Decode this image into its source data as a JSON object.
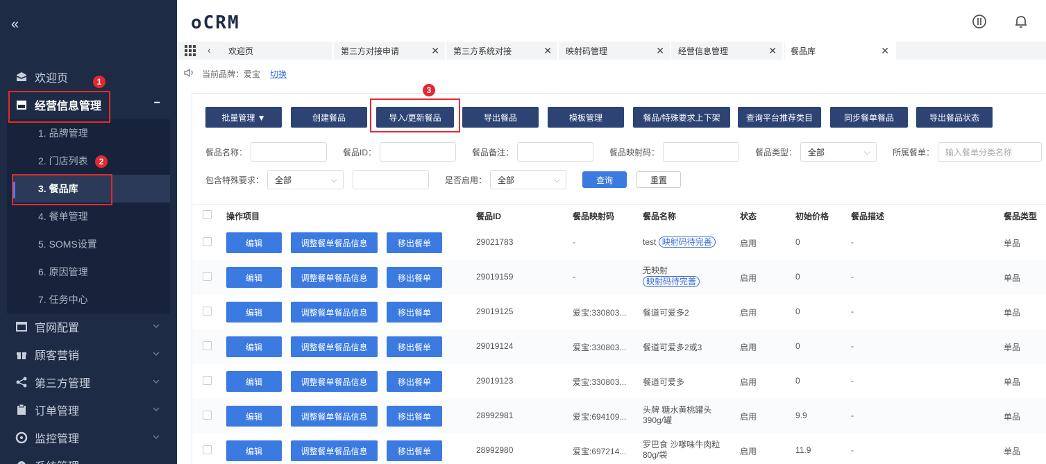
{
  "sidebar": {
    "collapse_icon": "«",
    "menu": [
      {
        "label": "欢迎页",
        "icon": "inbox-icon"
      },
      {
        "label": "经营信息管理",
        "icon": "storefront-icon",
        "open_symbol": "−"
      },
      {
        "label": "官网配置",
        "icon": "window-icon"
      },
      {
        "label": "顾客营销",
        "icon": "gift-icon"
      },
      {
        "label": "第三方管理",
        "icon": "share-icon"
      },
      {
        "label": "订单管理",
        "icon": "clipboard-icon"
      },
      {
        "label": "监控管理",
        "icon": "gauge-icon"
      },
      {
        "label": "系统管理",
        "icon": "gear-icon"
      }
    ],
    "submenu": [
      {
        "label": "1. 品牌管理"
      },
      {
        "label": "2. 门店列表"
      },
      {
        "label": "3. 餐品库"
      },
      {
        "label": "4. 餐单管理"
      },
      {
        "label": "5. SOMS设置"
      },
      {
        "label": "6. 原因管理"
      },
      {
        "label": "7. 任务中心"
      }
    ]
  },
  "annotations": {
    "badge1": "1",
    "badge2": "2",
    "badge3": "3"
  },
  "header": {
    "logo": "oCRM"
  },
  "tabs": [
    {
      "label": "欢迎页",
      "close": ""
    },
    {
      "label": "第三方对接申请",
      "close": "✕"
    },
    {
      "label": "第三方系统对接",
      "close": "✕"
    },
    {
      "label": "映射码管理",
      "close": "✕"
    },
    {
      "label": "经营信息管理",
      "close": "✕"
    },
    {
      "label": "餐品库",
      "close": "✕"
    }
  ],
  "brand": {
    "current": "当前品牌：爱宝",
    "switch": "切换"
  },
  "toolbar": [
    "批量管理 ▼",
    "创建餐品",
    "导入/更新餐品",
    "导出餐品",
    "模板管理",
    "餐品/特殊要求上下架",
    "查询平台推荐类目",
    "同步餐单餐品",
    "导出餐品状态"
  ],
  "filters": {
    "name_label": "餐品名称：",
    "id_label": "餐品ID：",
    "note_label": "餐品备注：",
    "map_label": "餐品映射码：",
    "type_label": "餐品类型：",
    "type_value": "全部",
    "menu_label": "所属餐单：",
    "menu_placeholder": "输入餐单分类名称",
    "special_label": "包含特殊要求：",
    "special_value": "全部",
    "enabled_label": "是否启用：",
    "enabled_value": "全部",
    "query": "查询",
    "reset": "重置"
  },
  "table": {
    "headers": [
      "操作项目",
      "餐品ID",
      "餐品映射码",
      "餐品名称",
      "状态",
      "初始价格",
      "餐品描述",
      "餐品类型"
    ],
    "actions": [
      "编辑",
      "调整餐单餐品信息",
      "移出餐单"
    ],
    "rows": [
      {
        "id": "29021783",
        "map": "-",
        "name": "test",
        "tag": "映射码待完善",
        "status": "启用",
        "price": "0",
        "desc": "-",
        "type": "单品"
      },
      {
        "id": "29019159",
        "map": "-",
        "name": "无映射",
        "tag": "映射码待完善",
        "status": "启用",
        "price": "0",
        "desc": "-",
        "type": "单品"
      },
      {
        "id": "29019125",
        "map": "爱宝:330803...",
        "name": "餐道可爱多2",
        "tag": "",
        "status": "启用",
        "price": "0",
        "desc": "-",
        "type": "单品"
      },
      {
        "id": "29019124",
        "map": "爱宝:330803...",
        "name": "餐道可爱多2或3",
        "tag": "",
        "status": "启用",
        "price": "0",
        "desc": "-",
        "type": "单品"
      },
      {
        "id": "29019123",
        "map": "爱宝:330803...",
        "name": "餐道可爱多",
        "tag": "",
        "status": "启用",
        "price": "0",
        "desc": "-",
        "type": "单品"
      },
      {
        "id": "28992981",
        "map": "爱宝:694109...",
        "name": "头牌 糖水黄桃罐头 390g/罐",
        "tag": "",
        "status": "启用",
        "price": "9.9",
        "desc": "-",
        "type": "单品"
      },
      {
        "id": "28992980",
        "map": "爱宝:697214...",
        "name": "罗巴食 沙嗲味牛肉粒 80g/袋",
        "tag": "",
        "status": "启用",
        "price": "11.9",
        "desc": "-",
        "type": "单品"
      }
    ]
  }
}
